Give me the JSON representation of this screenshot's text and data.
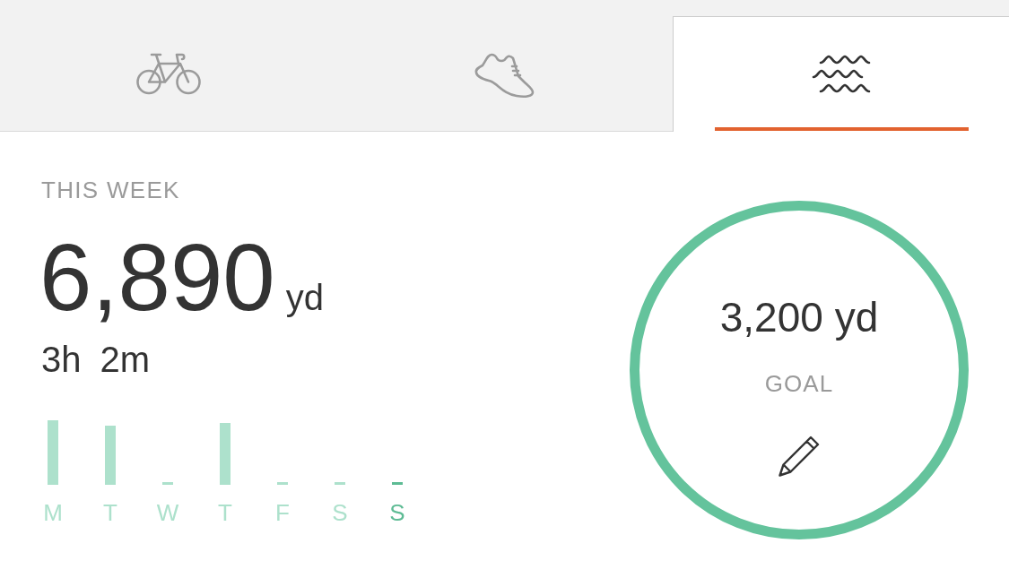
{
  "tabs": [
    {
      "kind": "bike",
      "selected": false
    },
    {
      "kind": "run",
      "selected": false
    },
    {
      "kind": "swim",
      "selected": true
    }
  ],
  "summary": {
    "label": "THIS WEEK",
    "distance": "6,890",
    "unit": "yd",
    "duration": "3h 2m"
  },
  "week": {
    "days": [
      {
        "label": "M",
        "selected": false
      },
      {
        "label": "T",
        "selected": false
      },
      {
        "label": "W",
        "selected": false
      },
      {
        "label": "T",
        "selected": false
      },
      {
        "label": "F",
        "selected": false
      },
      {
        "label": "S",
        "selected": false
      },
      {
        "label": "S",
        "selected": true
      }
    ]
  },
  "goal": {
    "value": "3,200 yd",
    "label": "GOAL",
    "level": 1
  }
}
